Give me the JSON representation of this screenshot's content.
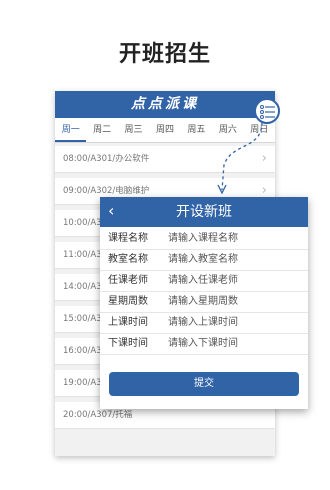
{
  "headline": "开班招生",
  "app": {
    "title": "点点派课",
    "days": [
      "周一",
      "周二",
      "周三",
      "周四",
      "周五",
      "周六",
      "周日"
    ],
    "active_day_index": 0,
    "schedule": [
      "08:00/A301/办公软件",
      "09:00/A302/电脑维护",
      "10:00/A3",
      "11:00/A3",
      "14:00/A3",
      "15:00/A3",
      "16:00/A3",
      "19:00/A3",
      "20:00/A307/托福"
    ]
  },
  "dialog": {
    "title": "开设新班",
    "fields": [
      {
        "label": "课程名称",
        "placeholder": "请输入课程名称"
      },
      {
        "label": "教室名称",
        "placeholder": "请输入教室名称"
      },
      {
        "label": "任课老师",
        "placeholder": "请输入任课老师"
      },
      {
        "label": "星期周数",
        "placeholder": "请输入星期周数"
      },
      {
        "label": "上课时间",
        "placeholder": "请输入上课时间"
      },
      {
        "label": "下课时间",
        "placeholder": "请输入下课时间"
      }
    ],
    "submit_label": "提交"
  },
  "colors": {
    "primary": "#3163a7"
  },
  "icons": {
    "menu": "list-menu-icon",
    "back": "chevron-left-icon",
    "row": "chevron-right-icon"
  }
}
